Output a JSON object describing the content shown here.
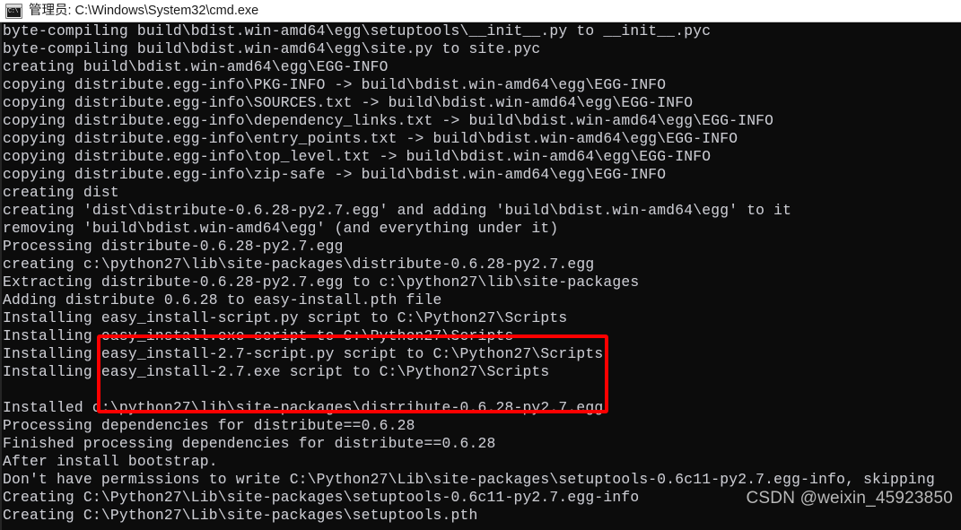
{
  "window": {
    "titlebar": {
      "icon": "cmd-window-icon",
      "icon_text": "C:\\",
      "title": "管理员: C:\\Windows\\System32\\cmd.exe",
      "background_color": "#ffffff",
      "text_color": "#1b1b1b"
    },
    "console": {
      "background_color": "#0c0c0c",
      "text_color": "#ccccd0",
      "lines": [
        "byte-compiling build\\bdist.win-amd64\\egg\\setuptools\\__init__.py to __init__.pyc",
        "byte-compiling build\\bdist.win-amd64\\egg\\site.py to site.pyc",
        "creating build\\bdist.win-amd64\\egg\\EGG-INFO",
        "copying distribute.egg-info\\PKG-INFO -> build\\bdist.win-amd64\\egg\\EGG-INFO",
        "copying distribute.egg-info\\SOURCES.txt -> build\\bdist.win-amd64\\egg\\EGG-INFO",
        "copying distribute.egg-info\\dependency_links.txt -> build\\bdist.win-amd64\\egg\\EGG-INFO",
        "copying distribute.egg-info\\entry_points.txt -> build\\bdist.win-amd64\\egg\\EGG-INFO",
        "copying distribute.egg-info\\top_level.txt -> build\\bdist.win-amd64\\egg\\EGG-INFO",
        "copying distribute.egg-info\\zip-safe -> build\\bdist.win-amd64\\egg\\EGG-INFO",
        "creating dist",
        "creating 'dist\\distribute-0.6.28-py2.7.egg' and adding 'build\\bdist.win-amd64\\egg' to it",
        "removing 'build\\bdist.win-amd64\\egg' (and everything under it)",
        "Processing distribute-0.6.28-py2.7.egg",
        "creating c:\\python27\\lib\\site-packages\\distribute-0.6.28-py2.7.egg",
        "Extracting distribute-0.6.28-py2.7.egg to c:\\python27\\lib\\site-packages",
        "Adding distribute 0.6.28 to easy-install.pth file",
        "Installing easy_install-script.py script to C:\\Python27\\Scripts",
        "Installing easy_install.exe script to C:\\Python27\\Scripts",
        "Installing easy_install-2.7-script.py script to C:\\Python27\\Scripts",
        "Installing easy_install-2.7.exe script to C:\\Python27\\Scripts",
        "",
        "Installed c:\\python27\\lib\\site-packages\\distribute-0.6.28-py2.7.egg",
        "Processing dependencies for distribute==0.6.28",
        "Finished processing dependencies for distribute==0.6.28",
        "After install bootstrap.",
        "Don't have permissions to write C:\\Python27\\Lib\\site-packages\\setuptools-0.6c11-py2.7.egg-info, skipping",
        "Creating C:\\Python27\\Lib\\site-packages\\setuptools-0.6c11-py2.7.egg-info",
        "Creating C:\\Python27\\Lib\\site-packages\\setuptools.pth"
      ]
    },
    "annotation": {
      "type": "red-rectangle-highlight",
      "color": "#fe0000",
      "highlighted_lines": [
        "easy_install-script.py script to C:\\Python27\\Scripts",
        "easy_install.exe script to C:\\Python27\\Scripts",
        "easy_install-2.7-script.py script to C:\\Python27\\Scripts",
        "easy_install-2.7.exe script to C:\\Python27\\Scripts"
      ]
    },
    "watermark": {
      "text": "CSDN @weixin_45923850",
      "color": "#b8b8b8"
    }
  }
}
